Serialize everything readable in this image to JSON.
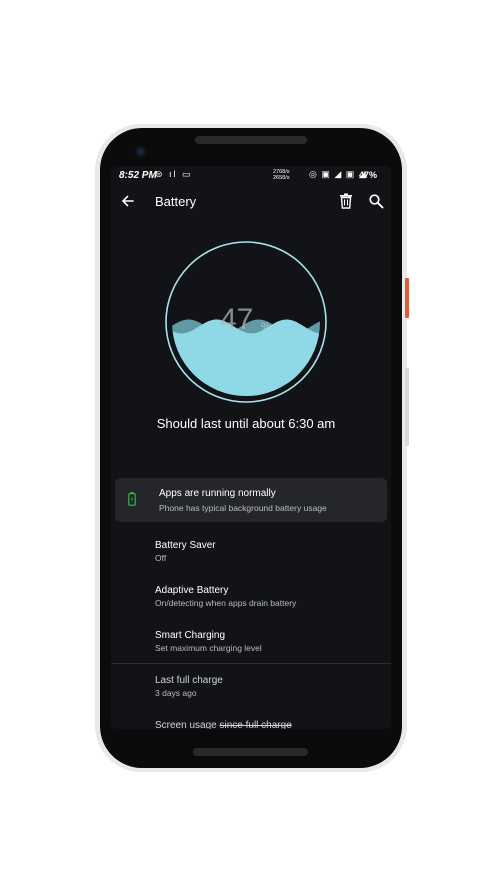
{
  "status_bar": {
    "time": "8:52 PM",
    "left_icons": "⊜ ıl ▭",
    "net_speed_up": "2768/s",
    "net_speed_down": "2658/s",
    "right_icons": "◎ ▣ ◢ ▣ ◢",
    "battery": "47%"
  },
  "app_bar": {
    "title": "Battery",
    "icons": [
      "arrow-left-icon",
      "trash-icon",
      "search-icon"
    ]
  },
  "gauge": {
    "level_percent": 47,
    "number": "47",
    "percent_sign": "%",
    "colors": {
      "ring": "#a9e2ec",
      "wave": "#8fd8e6",
      "wave_back": "#5f9aa6"
    }
  },
  "estimate": "Should last until about 6:30 am",
  "status_card": {
    "title": "Apps are running normally",
    "subtitle": "Phone has typical background battery usage",
    "icon": "battery-icon",
    "icon_color": "#37b24d"
  },
  "settings": [
    {
      "title": "Battery Saver",
      "subtitle": "Off"
    },
    {
      "title": "Adaptive Battery",
      "subtitle": "On/detecting when apps drain battery"
    },
    {
      "title": "Smart Charging",
      "subtitle": "Set maximum charging level"
    }
  ],
  "info": [
    {
      "title": "Last full charge",
      "subtitle": "3 days ago"
    }
  ],
  "screen_usage": {
    "label": "Screen usage",
    "struck": "since full charge"
  }
}
